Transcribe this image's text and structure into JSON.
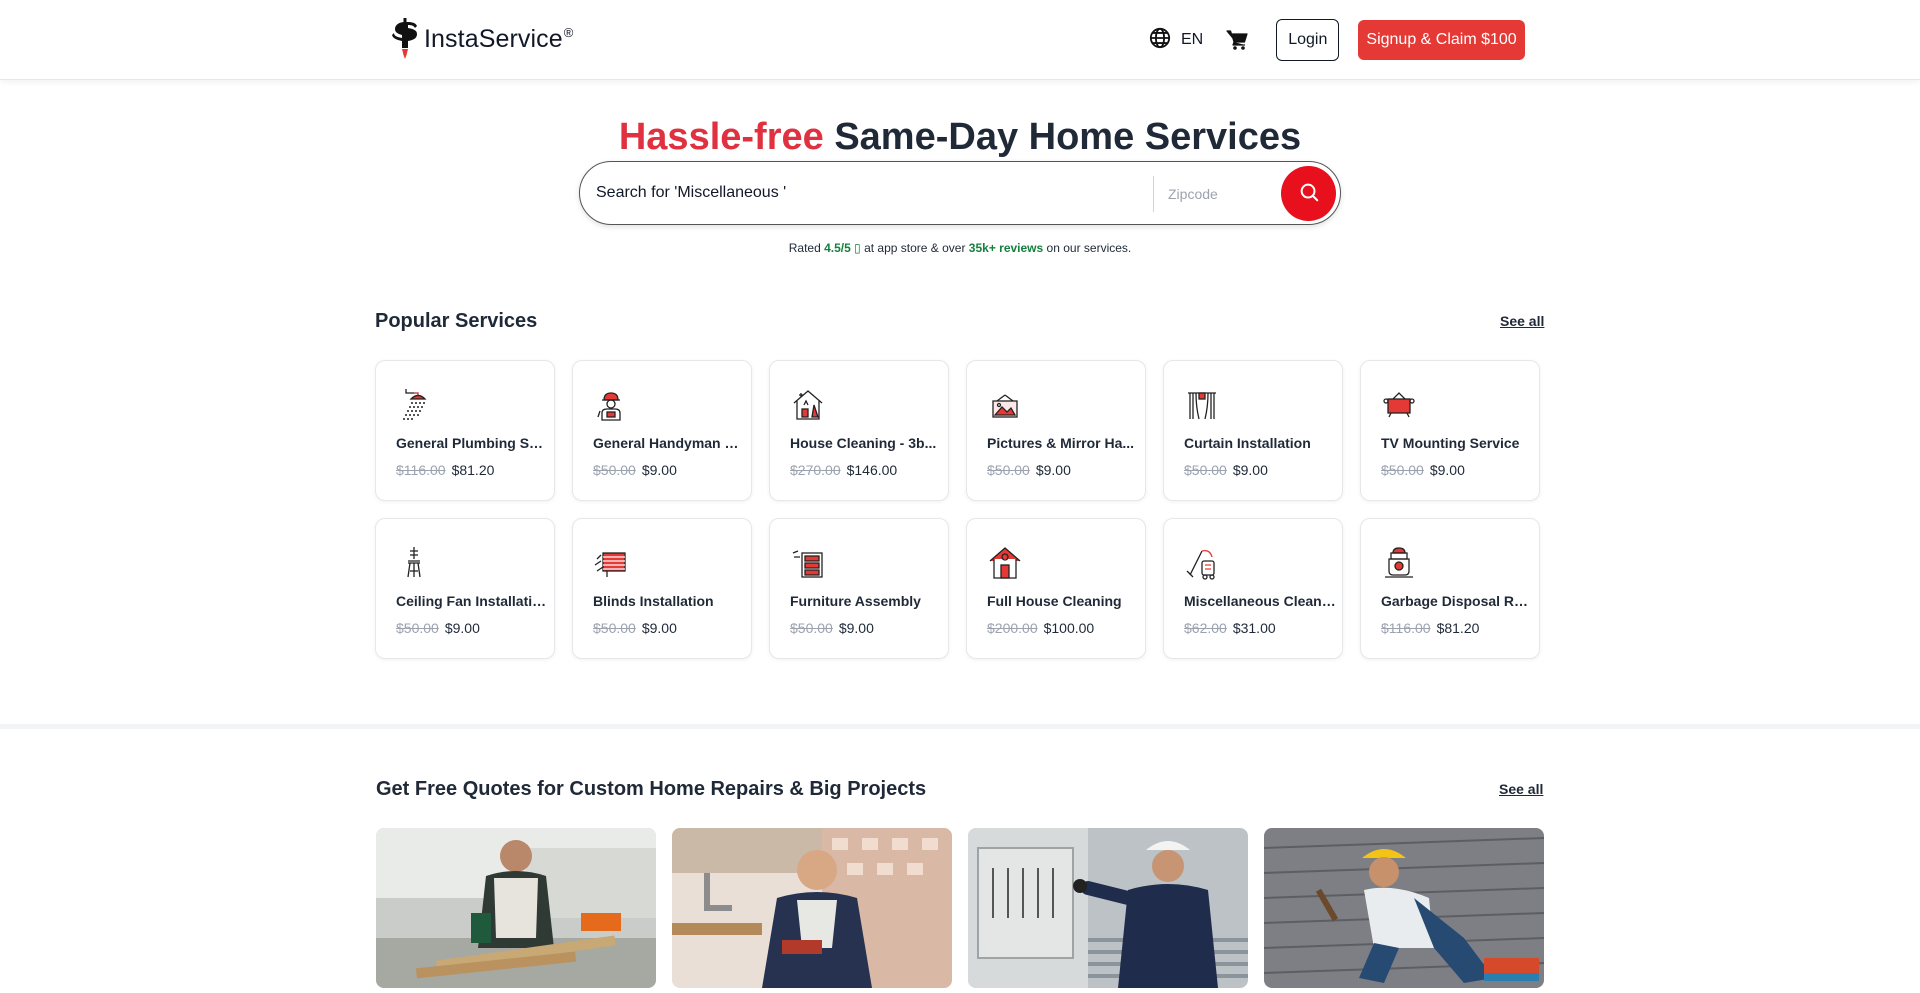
{
  "header": {
    "brand": "InstaService",
    "brand_mark": "®",
    "lang_code": "EN",
    "login_label": "Login",
    "signup_label": "Signup & Claim $100"
  },
  "hero": {
    "title_accent": "Hassle-free",
    "title_rest": " Same-Day Home Services",
    "search_placeholder": "Search for 'Miscellaneous '",
    "zip_placeholder": "Zipcode",
    "rating_prefix": "Rated ",
    "rating_value": "4.5/5 ",
    "rating_mid": " at app store & over ",
    "reviews": "35k+ reviews",
    "rating_suffix": " on our services."
  },
  "popular": {
    "title": "Popular Services",
    "see_all": "See all",
    "items": [
      {
        "name": "General Plumbing Se...",
        "old": "$116.00",
        "price": "$81.20",
        "icon": "shower-icon"
      },
      {
        "name": "General Handyman S...",
        "old": "$50.00",
        "price": "$9.00",
        "icon": "handyman-icon"
      },
      {
        "name": "House Cleaning - 3b...",
        "old": "$270.00",
        "price": "$146.00",
        "icon": "house-clean-icon"
      },
      {
        "name": "Pictures & Mirror Ha...",
        "old": "$50.00",
        "price": "$9.00",
        "icon": "picture-frame-icon"
      },
      {
        "name": "Curtain Installation",
        "old": "$50.00",
        "price": "$9.00",
        "icon": "curtain-icon"
      },
      {
        "name": "TV Mounting Service",
        "old": "$50.00",
        "price": "$9.00",
        "icon": "tv-icon"
      },
      {
        "name": "Ceiling Fan Installation",
        "old": "$50.00",
        "price": "$9.00",
        "icon": "ceiling-fan-icon"
      },
      {
        "name": "Blinds Installation",
        "old": "$50.00",
        "price": "$9.00",
        "icon": "blinds-icon"
      },
      {
        "name": "Furniture Assembly",
        "old": "$50.00",
        "price": "$9.00",
        "icon": "furniture-icon"
      },
      {
        "name": "Full House Cleaning",
        "old": "$200.00",
        "price": "$100.00",
        "icon": "full-house-icon"
      },
      {
        "name": "Miscellaneous Cleani...",
        "old": "$62.00",
        "price": "$31.00",
        "icon": "vacuum-icon"
      },
      {
        "name": "Garbage Disposal Re...",
        "old": "$116.00",
        "price": "$81.20",
        "icon": "disposal-icon"
      }
    ]
  },
  "quotes": {
    "title": "Get Free Quotes for Custom Home Repairs & Big Projects",
    "see_all": "See all"
  },
  "colors": {
    "accent": "#e03140",
    "signup": "#e53935",
    "search_button": "#e8101c",
    "green": "#15803d"
  }
}
